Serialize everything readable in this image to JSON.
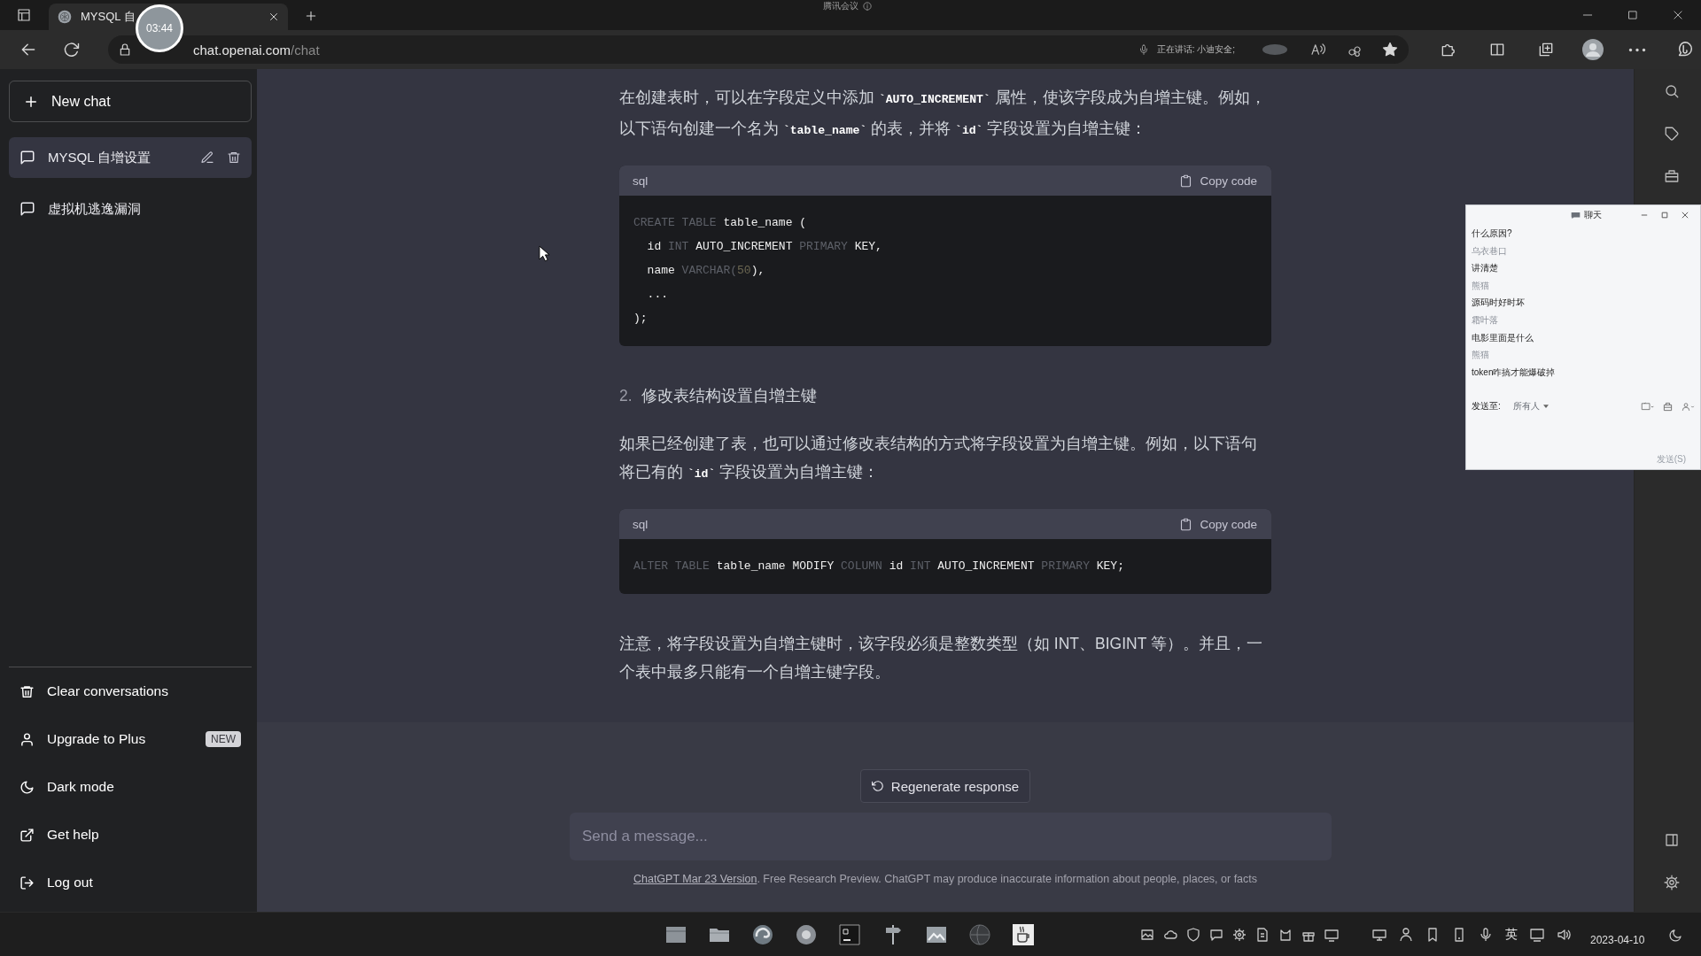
{
  "browser": {
    "tab": {
      "title": "MYSQL 自",
      "selected": true
    },
    "meeting_banner": "腾讯会议",
    "recording_timer": "03:44",
    "address": {
      "host": "chat.openai.com",
      "path": "/chat"
    },
    "speaking_status": "正在讲话: 小迪安全;"
  },
  "sidebar": {
    "new_chat": "New chat",
    "conversations": [
      {
        "title": "MYSQL 自增设置",
        "selected": true
      },
      {
        "title": "虚拟机逃逸漏洞",
        "selected": false
      }
    ],
    "menu": [
      {
        "kind": "trash",
        "label": "Clear conversations"
      },
      {
        "kind": "user",
        "label": "Upgrade to Plus",
        "badge": "NEW"
      },
      {
        "kind": "moon",
        "label": "Dark mode"
      },
      {
        "kind": "external",
        "label": "Get help"
      },
      {
        "kind": "logout",
        "label": "Log out"
      }
    ]
  },
  "message": {
    "blocks": [
      {
        "kind": "paragraph",
        "text": "在创建表时，可以在字段定义中添加 **`AUTO_INCREMENT`** 属性，使该字段成为自增主键。例如，以下语句创建一个名为 **`table_name`** 的表，并将 **`id`** 字段设置为自增主键："
      },
      {
        "kind": "code",
        "language": "sql",
        "copy": "Copy code",
        "lines": [
          [
            {
              "text": "CREATE TABLE",
              "kind": "keyword"
            },
            {
              "text": " table_name (",
              "kind": "plain"
            }
          ],
          [
            {
              "text": "  id ",
              "kind": "plain"
            },
            {
              "text": "INT",
              "kind": "keyword"
            },
            {
              "text": " AUTO_INCREMENT ",
              "kind": "plain"
            },
            {
              "text": "PRIMARY",
              "kind": "keyword"
            },
            {
              "text": " KEY,",
              "kind": "plain"
            }
          ],
          [
            {
              "text": "  name ",
              "kind": "plain"
            },
            {
              "text": "VARCHAR(",
              "kind": "keyword"
            },
            {
              "text": "50",
              "kind": "number"
            },
            {
              "text": "),",
              "kind": "plain"
            }
          ],
          [
            {
              "text": "  ...",
              "kind": "plain"
            }
          ],
          [
            {
              "text": ");",
              "kind": "plain"
            }
          ]
        ]
      },
      {
        "kind": "heading",
        "number": "2.",
        "text": "修改表结构设置自增主键"
      },
      {
        "kind": "paragraph",
        "text": "如果已经创建了表，也可以通过修改表结构的方式将字段设置为自增主键。例如，以下语句将已有的 **`id`** 字段设置为自增主键："
      },
      {
        "kind": "code",
        "language": "sql",
        "copy": "Copy code",
        "lines": [
          [
            {
              "text": "ALTER TABLE",
              "kind": "keyword"
            },
            {
              "text": " table_name MODIFY ",
              "kind": "plain"
            },
            {
              "text": "COLUMN",
              "kind": "keyword"
            },
            {
              "text": " id ",
              "kind": "plain"
            },
            {
              "text": "INT",
              "kind": "keyword"
            },
            {
              "text": " AUTO_INCREMENT ",
              "kind": "plain"
            },
            {
              "text": "PRIMARY",
              "kind": "keyword"
            },
            {
              "text": " KEY;",
              "kind": "plain"
            }
          ]
        ]
      },
      {
        "kind": "paragraph",
        "text": "注意，将字段设置为自增主键时，该字段必须是整数类型（如 INT、BIGINT 等）。并且，一个表中最多只能有一个自增主键字段。"
      }
    ]
  },
  "composer": {
    "regenerate": "Regenerate response",
    "placeholder": "Send a message...",
    "footer_link": "ChatGPT Mar 23 Version",
    "footer_text": ". Free Research Preview. ChatGPT may produce inaccurate information about people, places, or facts"
  },
  "chat_window": {
    "title": "聊天",
    "messages": [
      {
        "kind": "message",
        "text": "什么原因?"
      },
      {
        "kind": "sender",
        "text": "乌衣巷口"
      },
      {
        "kind": "message",
        "text": "讲清楚"
      },
      {
        "kind": "sender",
        "text": "熊猫"
      },
      {
        "kind": "message",
        "text": "源码时好时坏"
      },
      {
        "kind": "sender",
        "text": "霜叶落"
      },
      {
        "kind": "message",
        "text": "电影里面是什么"
      },
      {
        "kind": "sender",
        "text": "熊猫"
      },
      {
        "kind": "message",
        "text": "token咋搞才能爆破掉"
      }
    ],
    "send_to_label": "发送至:",
    "recipient": "所有人",
    "send_button": "发送(S)"
  },
  "taskbar": {
    "input_method": "英",
    "date": "2023-04-10"
  }
}
